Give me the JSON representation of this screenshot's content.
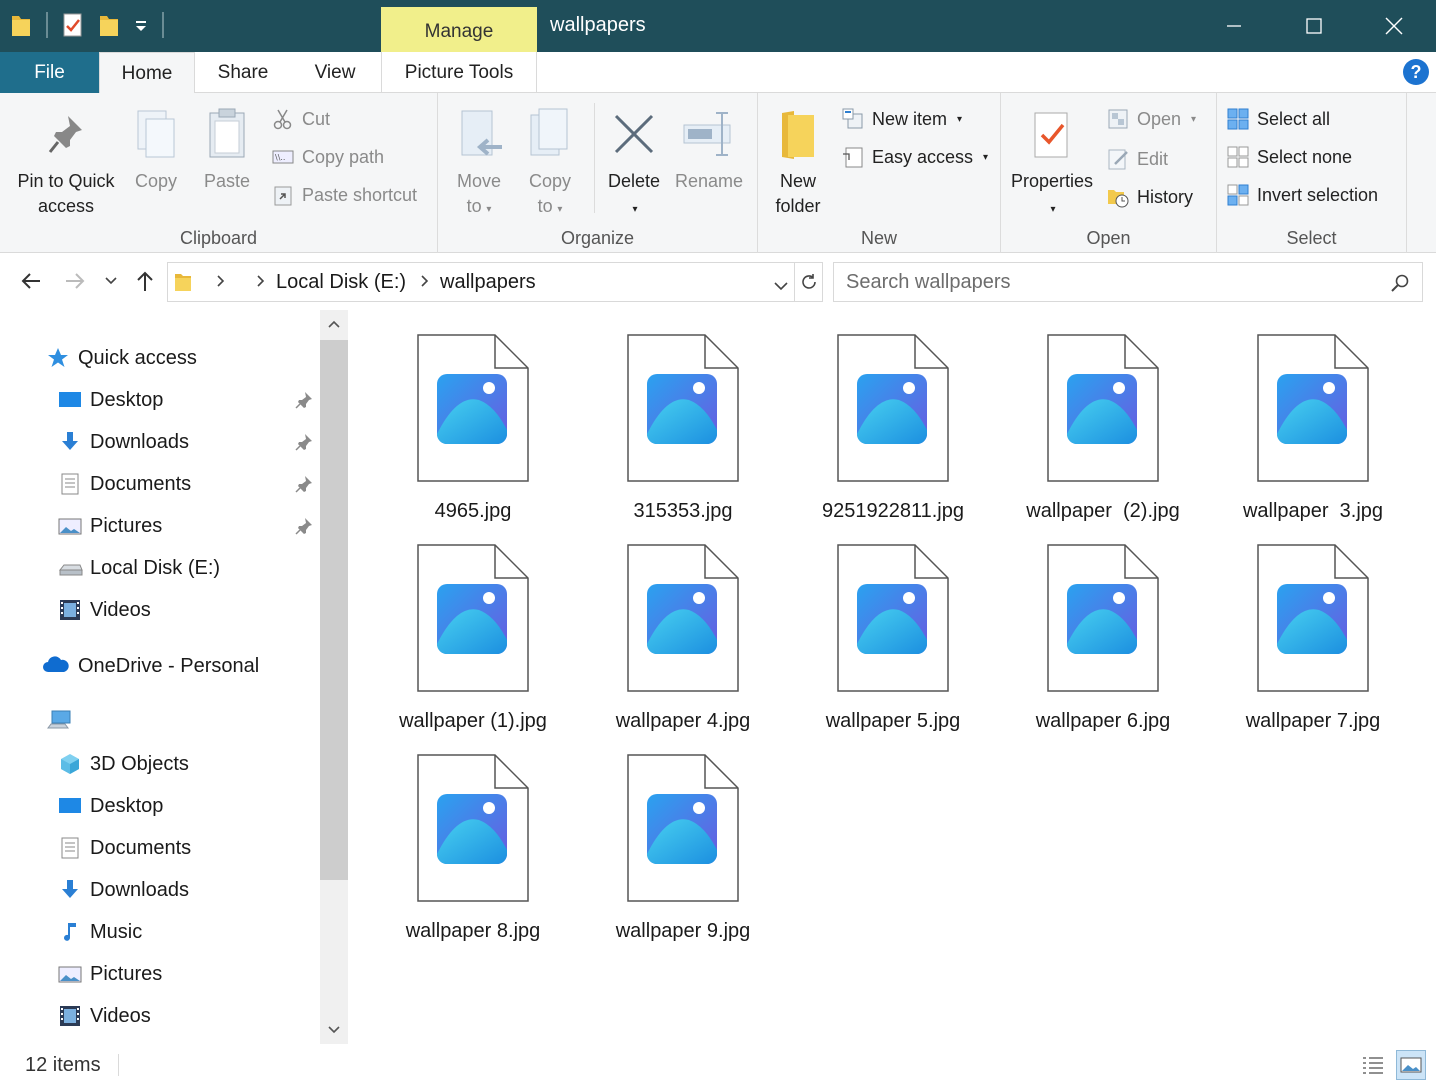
{
  "window": {
    "title": "wallpapers",
    "contextual_tab": "Manage",
    "controls": [
      "minimize",
      "maximize",
      "close"
    ]
  },
  "tabs": {
    "file": "File",
    "home": "Home",
    "share": "Share",
    "view": "View",
    "picture_tools": "Picture Tools"
  },
  "help_label": "?",
  "ribbon": {
    "clipboard": {
      "label": "Clipboard",
      "pin_line1": "Pin to Quick",
      "pin_line2": "access",
      "copy": "Copy",
      "paste": "Paste",
      "cut": "Cut",
      "copy_path": "Copy path",
      "paste_shortcut": "Paste shortcut"
    },
    "organize": {
      "label": "Organize",
      "move_line1": "Move",
      "move_line2": "to",
      "copy_line1": "Copy",
      "copy_line2": "to",
      "delete": "Delete",
      "rename": "Rename"
    },
    "new": {
      "label": "New",
      "folder_line1": "New",
      "folder_line2": "folder",
      "new_item": "New item",
      "easy_access": "Easy access"
    },
    "open": {
      "label": "Open",
      "properties": "Properties",
      "open": "Open",
      "edit": "Edit",
      "history": "History"
    },
    "select": {
      "label": "Select",
      "select_all": "Select all",
      "select_none": "Select none",
      "invert": "Invert selection"
    }
  },
  "address": {
    "crumbs": [
      "Local Disk (E:)",
      "wallpapers"
    ],
    "search_placeholder": "Search wallpapers"
  },
  "nav": {
    "quick_access": "Quick access",
    "quick_items": [
      {
        "label": "Desktop",
        "icon": "desktop-icon",
        "pinned": true
      },
      {
        "label": "Downloads",
        "icon": "downloads-icon",
        "pinned": true
      },
      {
        "label": "Documents",
        "icon": "documents-icon",
        "pinned": true
      },
      {
        "label": "Pictures",
        "icon": "pictures-icon",
        "pinned": true
      },
      {
        "label": "Local Disk (E:)",
        "icon": "drive-icon",
        "pinned": false
      },
      {
        "label": "Videos",
        "icon": "videos-icon",
        "pinned": false
      }
    ],
    "onedrive": "OneDrive - Personal",
    "this_pc_items": [
      {
        "label": "3D Objects",
        "icon": "3d-objects-icon"
      },
      {
        "label": "Desktop",
        "icon": "desktop-icon"
      },
      {
        "label": "Documents",
        "icon": "documents-icon"
      },
      {
        "label": "Downloads",
        "icon": "downloads-icon"
      },
      {
        "label": "Music",
        "icon": "music-icon"
      },
      {
        "label": "Pictures",
        "icon": "pictures-icon"
      },
      {
        "label": "Videos",
        "icon": "videos-icon"
      }
    ]
  },
  "files": [
    "4965.jpg",
    "315353.jpg",
    "9251922811.jpg",
    "wallpaper  (2).jpg",
    "wallpaper  3.jpg",
    "wallpaper (1).jpg",
    "wallpaper 4.jpg",
    "wallpaper 5.jpg",
    "wallpaper 6.jpg",
    "wallpaper 7.jpg",
    "wallpaper 8.jpg",
    "wallpaper 9.jpg"
  ],
  "status": {
    "item_count": "12 items"
  },
  "colors": {
    "titlebar": "#1f4e5a",
    "file_tab": "#1f6e8c",
    "manage_tab": "#f1ef8b",
    "accent": "#1c73d0"
  }
}
